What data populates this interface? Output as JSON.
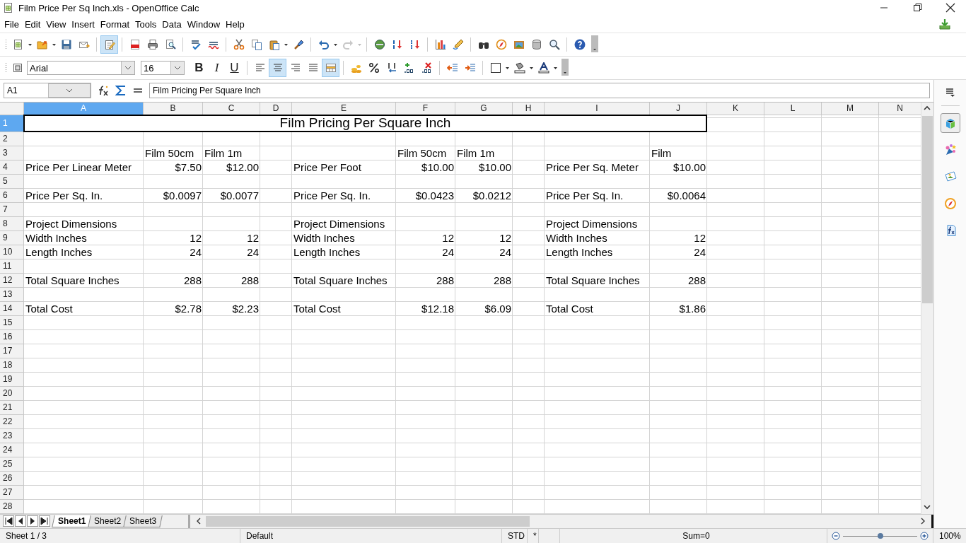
{
  "window": {
    "title": "Film Price Per Sq Inch.xls - OpenOffice Calc"
  },
  "menu": [
    {
      "label": "File"
    },
    {
      "label": "Edit"
    },
    {
      "label": "View"
    },
    {
      "label": "Insert"
    },
    {
      "label": "Format"
    },
    {
      "label": "Tools"
    },
    {
      "label": "Data"
    },
    {
      "label": "Window"
    },
    {
      "label": "Help"
    }
  ],
  "standard_toolbar": {
    "edit_file_on": true,
    "redo_disabled": true
  },
  "formatting_toolbar": {
    "font": "Arial",
    "size": "16",
    "merge_cells_on": true,
    "style_buttons": [
      {
        "label": "B",
        "kind": "bold",
        "on": false
      },
      {
        "label": "I",
        "kind": "italic",
        "on": false
      },
      {
        "label": "U",
        "kind": "underline",
        "on": false
      }
    ],
    "alignment_buttons": [
      {
        "kind": "left",
        "selected": false
      },
      {
        "kind": "center",
        "selected": true
      },
      {
        "kind": "right",
        "selected": false
      },
      {
        "kind": "justify",
        "selected": false
      }
    ]
  },
  "formula_bar": {
    "cell_reference": "A1",
    "content": "Film Pricing Per Square Inch"
  },
  "columns": [
    {
      "label": "A",
      "selected": true
    },
    {
      "label": "B",
      "selected": false
    },
    {
      "label": "C",
      "selected": false
    },
    {
      "label": "D",
      "selected": false
    },
    {
      "label": "E",
      "selected": false
    },
    {
      "label": "F",
      "selected": false
    },
    {
      "label": "G",
      "selected": false
    },
    {
      "label": "H",
      "selected": false
    },
    {
      "label": "I",
      "selected": false
    },
    {
      "label": "J",
      "selected": false
    },
    {
      "label": "K",
      "selected": false
    },
    {
      "label": "L",
      "selected": false
    },
    {
      "label": "M",
      "selected": false
    },
    {
      "label": "N",
      "selected": false
    }
  ],
  "rows": [
    {
      "label": "1",
      "selected": true,
      "kind": "title",
      "cells": [
        {
          "text": "Film Pricing Per Square Inch"
        }
      ]
    },
    {
      "label": "2",
      "selected": false,
      "kind": "data"
    },
    {
      "label": "3",
      "selected": false,
      "kind": "data",
      "cells": [
        null,
        {
          "text": "Film 50cm",
          "kind": "label"
        },
        {
          "text": "Film 1m",
          "kind": "label"
        },
        null,
        null,
        {
          "text": "Film 50cm",
          "kind": "label"
        },
        {
          "text": "Film 1m",
          "kind": "label"
        },
        null,
        null,
        {
          "text": "Film",
          "kind": "label"
        }
      ]
    },
    {
      "label": "4",
      "selected": false,
      "kind": "data",
      "cells": [
        {
          "text": "Price Per Linear Meter",
          "kind": "label"
        },
        {
          "text": "$7.50",
          "kind": "number"
        },
        {
          "text": "$12.00",
          "kind": "number"
        },
        null,
        {
          "text": "Price Per Foot",
          "kind": "label"
        },
        {
          "text": "$10.00",
          "kind": "number"
        },
        {
          "text": "$10.00",
          "kind": "number"
        },
        null,
        {
          "text": "Price Per Sq. Meter",
          "kind": "label"
        },
        {
          "text": "$10.00",
          "kind": "number"
        }
      ]
    },
    {
      "label": "5",
      "selected": false,
      "kind": "data"
    },
    {
      "label": "6",
      "selected": false,
      "kind": "data",
      "cells": [
        {
          "text": "Price Per Sq. In.",
          "kind": "label"
        },
        {
          "text": "$0.0097",
          "kind": "number"
        },
        {
          "text": "$0.0077",
          "kind": "number"
        },
        null,
        {
          "text": "Price Per Sq. In.",
          "kind": "label"
        },
        {
          "text": "$0.0423",
          "kind": "number"
        },
        {
          "text": "$0.0212",
          "kind": "number"
        },
        null,
        {
          "text": "Price Per Sq. In.",
          "kind": "label"
        },
        {
          "text": "$0.0064",
          "kind": "number"
        }
      ]
    },
    {
      "label": "7",
      "selected": false,
      "kind": "data"
    },
    {
      "label": "8",
      "selected": false,
      "kind": "data",
      "cells": [
        {
          "text": "Project Dimensions",
          "kind": "label"
        },
        null,
        null,
        null,
        {
          "text": "Project Dimensions",
          "kind": "label"
        },
        null,
        null,
        null,
        {
          "text": "Project Dimensions",
          "kind": "label"
        }
      ]
    },
    {
      "label": "9",
      "selected": false,
      "kind": "data",
      "cells": [
        {
          "text": "Width Inches",
          "kind": "label"
        },
        {
          "text": "12",
          "kind": "number"
        },
        {
          "text": "12",
          "kind": "number"
        },
        null,
        {
          "text": "Width Inches",
          "kind": "label"
        },
        {
          "text": "12",
          "kind": "number"
        },
        {
          "text": "12",
          "kind": "number"
        },
        null,
        {
          "text": "Width Inches",
          "kind": "label"
        },
        {
          "text": "12",
          "kind": "number"
        }
      ]
    },
    {
      "label": "10",
      "selected": false,
      "kind": "data",
      "cells": [
        {
          "text": "Length Inches",
          "kind": "label"
        },
        {
          "text": "24",
          "kind": "number"
        },
        {
          "text": "24",
          "kind": "number"
        },
        null,
        {
          "text": "Length Inches",
          "kind": "label"
        },
        {
          "text": "24",
          "kind": "number"
        },
        {
          "text": "24",
          "kind": "number"
        },
        null,
        {
          "text": "Length Inches",
          "kind": "label"
        },
        {
          "text": "24",
          "kind": "number"
        }
      ]
    },
    {
      "label": "11",
      "selected": false,
      "kind": "data"
    },
    {
      "label": "12",
      "selected": false,
      "kind": "data",
      "cells": [
        {
          "text": "Total Square Inches",
          "kind": "label"
        },
        {
          "text": "288",
          "kind": "number"
        },
        {
          "text": "288",
          "kind": "number"
        },
        null,
        {
          "text": "Total Square Inches",
          "kind": "label"
        },
        {
          "text": "288",
          "kind": "number"
        },
        {
          "text": "288",
          "kind": "number"
        },
        null,
        {
          "text": "Total Square Inches",
          "kind": "label"
        },
        {
          "text": "288",
          "kind": "number"
        }
      ]
    },
    {
      "label": "13",
      "selected": false,
      "kind": "data"
    },
    {
      "label": "14",
      "selected": false,
      "kind": "data",
      "cells": [
        {
          "text": "Total Cost",
          "kind": "label"
        },
        {
          "text": "$2.78",
          "kind": "number"
        },
        {
          "text": "$2.23",
          "kind": "number"
        },
        null,
        {
          "text": "Total Cost",
          "kind": "label"
        },
        {
          "text": "$12.18",
          "kind": "number"
        },
        {
          "text": "$6.09",
          "kind": "number"
        },
        null,
        {
          "text": "Total Cost",
          "kind": "label"
        },
        {
          "text": "$1.86",
          "kind": "number"
        }
      ]
    },
    {
      "label": "15",
      "selected": false,
      "kind": "data"
    },
    {
      "label": "16",
      "selected": false,
      "kind": "data"
    },
    {
      "label": "17",
      "selected": false,
      "kind": "data"
    },
    {
      "label": "18",
      "selected": false,
      "kind": "data"
    },
    {
      "label": "19",
      "selected": false,
      "kind": "data"
    },
    {
      "label": "20",
      "selected": false,
      "kind": "data"
    },
    {
      "label": "21",
      "selected": false,
      "kind": "data"
    },
    {
      "label": "22",
      "selected": false,
      "kind": "data"
    },
    {
      "label": "23",
      "selected": false,
      "kind": "data"
    },
    {
      "label": "24",
      "selected": false,
      "kind": "data"
    },
    {
      "label": "25",
      "selected": false,
      "kind": "data"
    },
    {
      "label": "26",
      "selected": false,
      "kind": "data"
    },
    {
      "label": "27",
      "selected": false,
      "kind": "data"
    },
    {
      "label": "28",
      "selected": false,
      "kind": "data"
    }
  ],
  "sheet_tabs": [
    {
      "label": "Sheet1",
      "selected": true
    },
    {
      "label": "Sheet2",
      "selected": false
    },
    {
      "label": "Sheet3",
      "selected": false
    }
  ],
  "sidebar": [
    {
      "kind": "properties",
      "selected": true
    },
    {
      "kind": "styles",
      "selected": false
    },
    {
      "kind": "gallery",
      "selected": false
    },
    {
      "kind": "navigator",
      "selected": false
    },
    {
      "kind": "functions",
      "selected": false
    }
  ],
  "status_bar": {
    "sheet": "Sheet 1 / 3",
    "page_style": "Default",
    "selection_mode": "STD",
    "modified": "*",
    "sum": "Sum=0",
    "zoom": {
      "level": 0.5
    },
    "zoom_percent": "100%"
  }
}
